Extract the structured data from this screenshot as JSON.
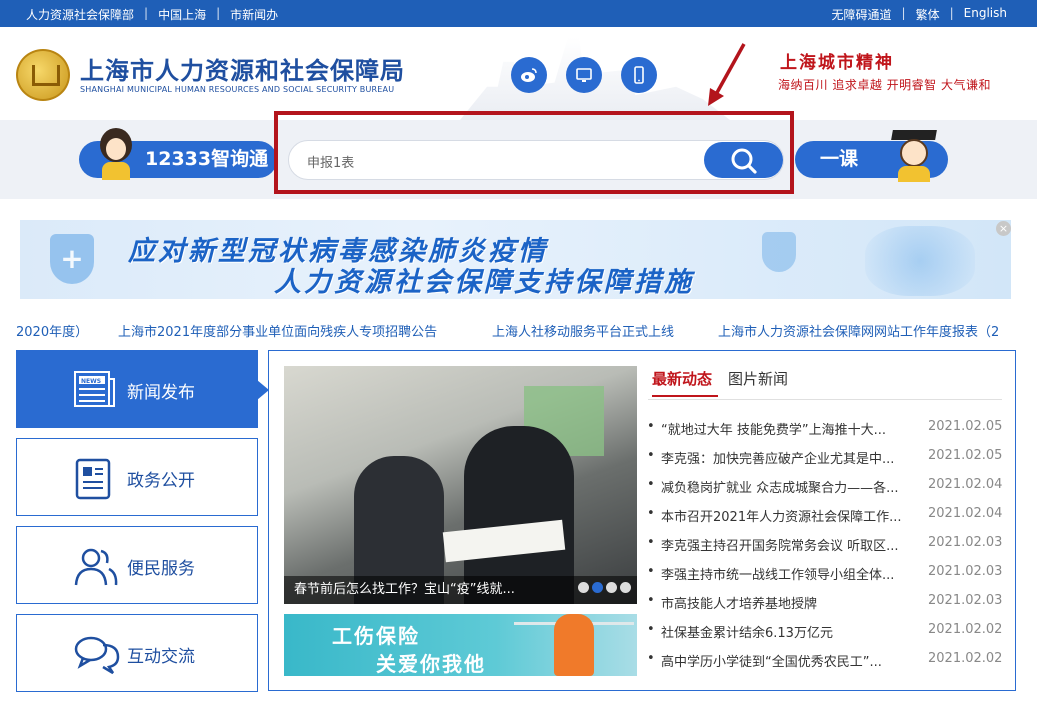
{
  "topbar": {
    "left_links": [
      "人力资源社会保障部",
      "中国上海",
      "市新闻办"
    ],
    "right_links": [
      "无障碍通道",
      "繁体",
      "English"
    ]
  },
  "header": {
    "title": "上海市人力资源和社会保障局",
    "subtitle": "SHANGHAI MUNICIPAL HUMAN RESOURCES AND SOCIAL SECURITY BUREAU",
    "social_icons": [
      "weibo-icon",
      "desktop-icon",
      "mobile-icon"
    ],
    "spirit_title": "上海城市精神",
    "spirit_motto": "海纳百川  追求卓越  开明睿智  大气谦和"
  },
  "search": {
    "left_pill": "12333智询通",
    "value": "申报1表",
    "right_pill": "一课"
  },
  "banner": {
    "line1": "应对新型冠状病毒感染肺炎疫情",
    "line2": "人力资源社会保障支持保障措施",
    "close": "×"
  },
  "ticker": [
    "2020年度）",
    "上海市2021年度部分事业单位面向残疾人专项招聘公告",
    "上海人社移动服务平台正式上线",
    "上海市人力资源社会保障网网站工作年度报表（2"
  ],
  "nav": [
    {
      "label": "新闻发布",
      "icon": "newspaper-icon"
    },
    {
      "label": "政务公开",
      "icon": "document-icon"
    },
    {
      "label": "便民服务",
      "icon": "people-icon"
    },
    {
      "label": "互动交流",
      "icon": "chat-icon"
    }
  ],
  "news": {
    "tabs": [
      "最新动态",
      "图片新闻"
    ],
    "photo_caption": "春节前后怎么找工作？宝山“疫”线就...",
    "promo_line1": "工伤保险",
    "promo_line2": "关爱你我他",
    "items": [
      {
        "title": "“就地过大年 技能免费学”上海推十大...",
        "date": "2021.02.05"
      },
      {
        "title": "李克强：加快完善应破产企业尤其是中...",
        "date": "2021.02.05"
      },
      {
        "title": "减负稳岗扩就业 众志成城聚合力——各...",
        "date": "2021.02.04"
      },
      {
        "title": "本市召开2021年人力资源社会保障工作...",
        "date": "2021.02.04"
      },
      {
        "title": "李克强主持召开国务院常务会议 听取区...",
        "date": "2021.02.03"
      },
      {
        "title": "李强主持市统一战线工作领导小组全体...",
        "date": "2021.02.03"
      },
      {
        "title": "市高技能人才培养基地授牌",
        "date": "2021.02.03"
      },
      {
        "title": "社保基金累计结余6.13万亿元",
        "date": "2021.02.02"
      },
      {
        "title": "高中学历小学徒到“全国优秀农民工”...",
        "date": "2021.02.02"
      }
    ]
  },
  "colors": {
    "primary": "#2a6bd1",
    "accent_red": "#c0151b"
  }
}
